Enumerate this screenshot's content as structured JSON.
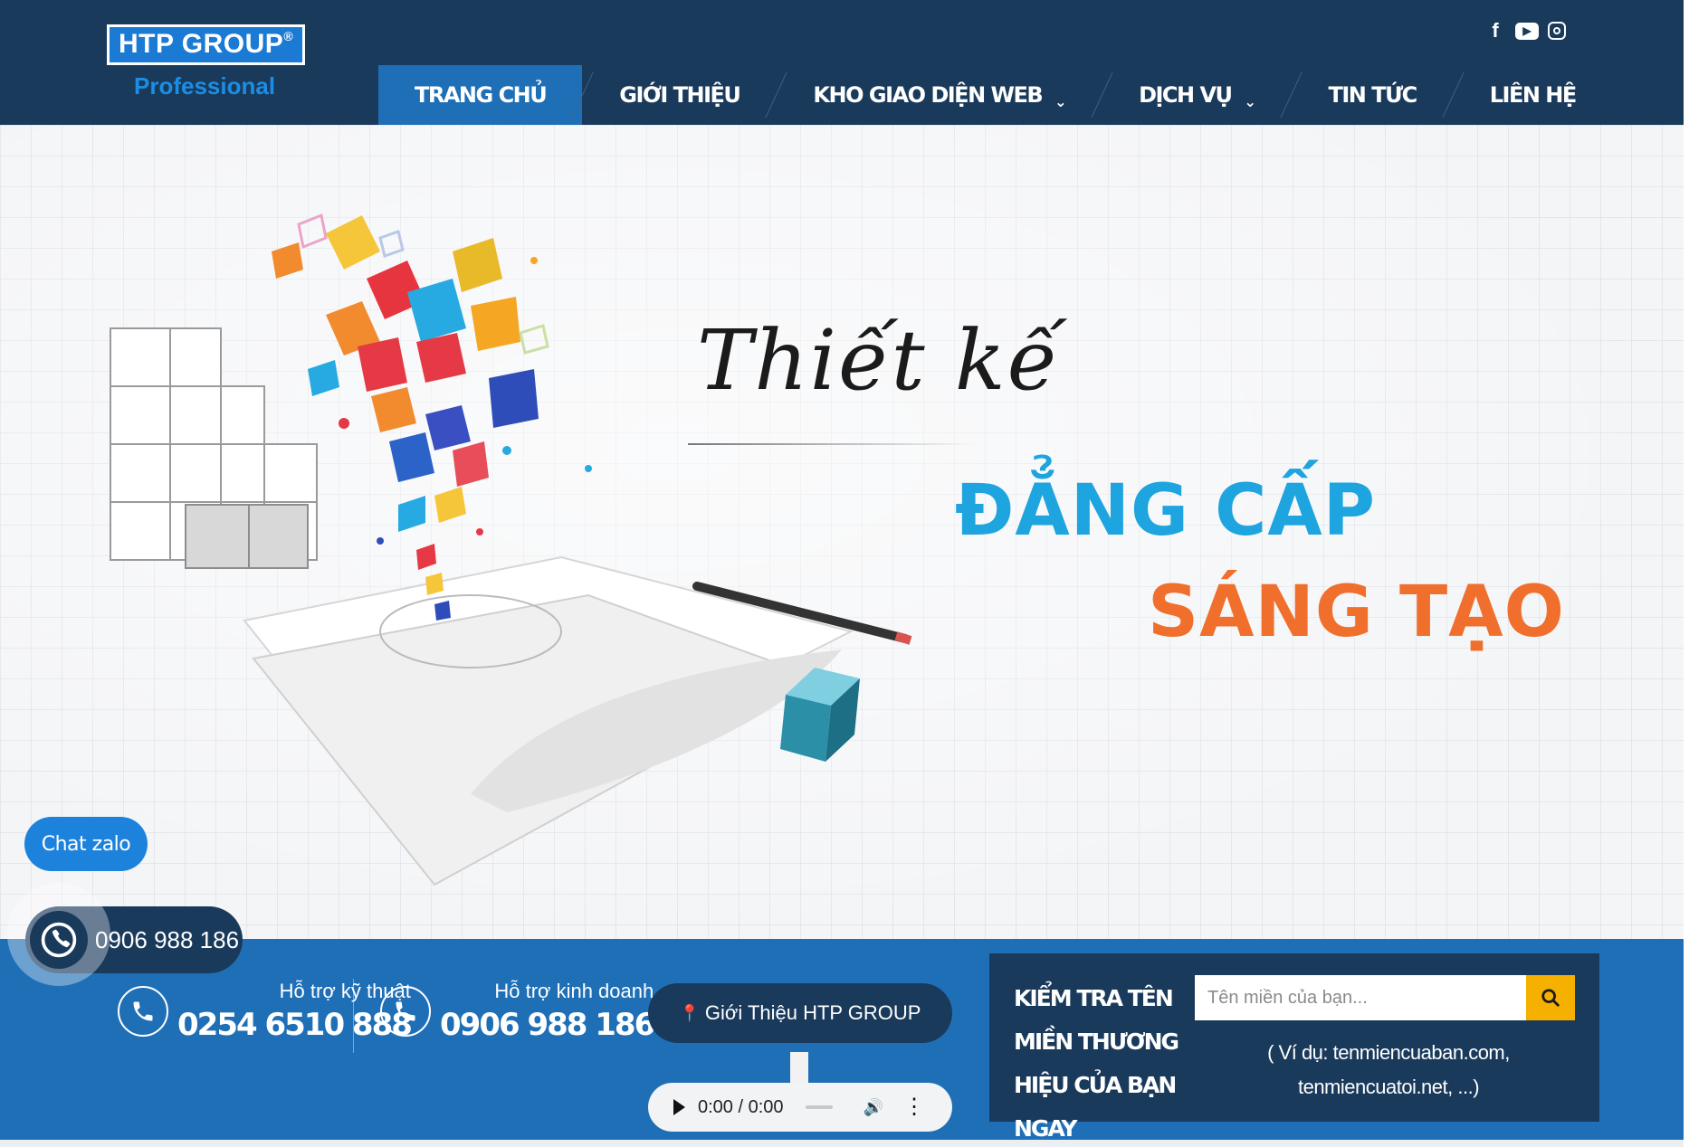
{
  "logo": {
    "brand": "HTP GROUP",
    "reg": "®",
    "subtitle": "Professional"
  },
  "social": {
    "facebook_icon": "facebook-icon",
    "youtube_icon": "youtube-icon",
    "instagram_icon": "instagram-icon"
  },
  "nav": {
    "items": [
      {
        "label": "TRANG CHỦ",
        "active": true
      },
      {
        "label": "GIỚI THIỆU"
      },
      {
        "label": "KHO GIAO DIỆN WEB",
        "caret": "⌄"
      },
      {
        "label": "DỊCH VỤ",
        "caret": "⌄"
      },
      {
        "label": "TIN TỨC"
      },
      {
        "label": "LIÊN HỆ"
      }
    ]
  },
  "hero": {
    "script": "Thiết kế",
    "line1": "ĐẲNG CẤP",
    "line2": "SÁNG TẠO",
    "colors": {
      "line1": "#1ea4de",
      "line2": "#f06f2d"
    }
  },
  "floating": {
    "chat_label": "Chat zalo",
    "phone": "0906 988 186"
  },
  "support": [
    {
      "label": "Hỗ trợ kỹ thuật",
      "value": "0254 6510 888"
    },
    {
      "label": "Hỗ trợ kinh doanh",
      "value": "0906 988 186"
    }
  ],
  "intro": {
    "label": "Giới Thiệu HTP GROUP"
  },
  "audio": {
    "time": "0:00 / 0:00"
  },
  "domain": {
    "title": "KIỂM TRA TÊN MIỀN THƯƠNG HIỆU CỦA BẠN NGAY",
    "placeholder": "Tên miền của bạn...",
    "hint": "( Ví dụ: tenmiencuaban.com, tenmiencuatoi.net, ...)"
  },
  "colors": {
    "header": "#1a3a5c",
    "accent": "#1f6fb7",
    "search": "#f5b000"
  }
}
